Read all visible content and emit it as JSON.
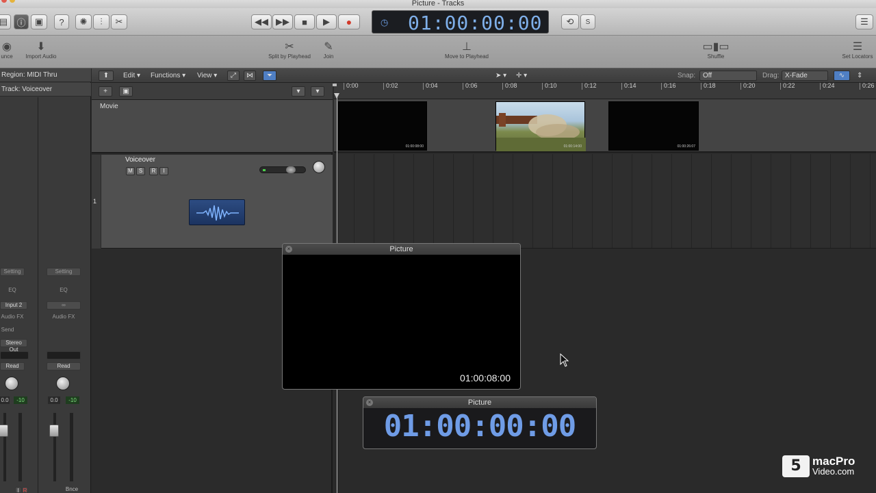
{
  "window": {
    "title": "Picture - Tracks"
  },
  "control_bar": {
    "timecode": "01:00:00:00",
    "transport": [
      "rewind",
      "fast-forward",
      "stop",
      "play",
      "record"
    ]
  },
  "toolbar": {
    "bounce_label": "unce",
    "import_audio_label": "Import Audio",
    "split_label": "Split by Playhead",
    "join_label": "Join",
    "move_label": "Move to Playhead",
    "shuffle_label": "Shuffle",
    "set_locators_label": "Set Locators"
  },
  "inspector": {
    "region_label": "Region: MIDI Thru",
    "track_label": "Track:  Voiceover",
    "strip1": {
      "setting": "Setting",
      "eq": "EQ",
      "input": "Input 2",
      "audio_fx": "Audio FX",
      "send": "Send",
      "output": "Stereo Out",
      "automation": "Read",
      "volume": "0.0",
      "peak": "-10",
      "buttons": [
        "I",
        "R"
      ]
    },
    "strip2": {
      "setting": "Setting",
      "eq": "EQ",
      "audio_fx": "Audio FX",
      "automation": "Read",
      "volume": "0.0",
      "peak": "-10",
      "output": "Bnce"
    }
  },
  "track_toolbar": {
    "edit": "Edit",
    "functions": "Functions",
    "view": "View",
    "snap_label": "Snap:",
    "snap_value": "Off",
    "drag_label": "Drag:",
    "drag_value": "X-Fade"
  },
  "ruler": {
    "ticks": [
      "0:00",
      "0:02",
      "0:04",
      "0:06",
      "0:08",
      "0:10",
      "0:12",
      "0:14",
      "0:16",
      "0:18",
      "0:20",
      "0:22",
      "0:24",
      "0:26"
    ]
  },
  "tracks": {
    "movie_name": "Movie",
    "voiceover_name": "Voiceover",
    "voiceover_number": "1",
    "msri": [
      "M",
      "S",
      "R",
      "I"
    ],
    "frame_timecodes": [
      "01:00:08:00",
      "01:00:14:00",
      "01:00:26:07"
    ]
  },
  "picture_window": {
    "title": "Picture",
    "timecode": "01:00:08:00"
  },
  "timecode_window": {
    "title": "Picture",
    "timecode": "01:00:00:00"
  },
  "watermark": {
    "line1": "macPro",
    "line2": "Video.com"
  },
  "colors": {
    "lcd_text": "#7fb0ea",
    "record": "#d23a2a",
    "accent_blue": "#4f7fc4"
  }
}
